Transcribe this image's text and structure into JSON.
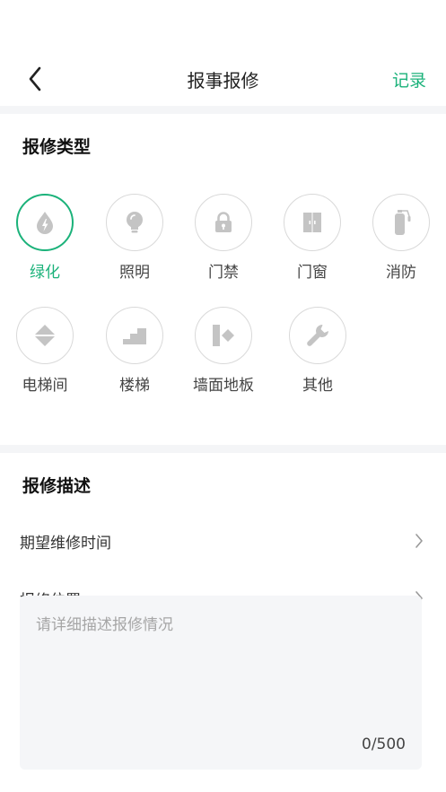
{
  "header": {
    "title": "报事报修",
    "record_label": "记录"
  },
  "type_section": {
    "title": "报修类型",
    "items": [
      {
        "label": "绿化",
        "icon": "water-drop-icon",
        "selected": true
      },
      {
        "label": "照明",
        "icon": "lightbulb-icon",
        "selected": false
      },
      {
        "label": "门禁",
        "icon": "lock-icon",
        "selected": false
      },
      {
        "label": "门窗",
        "icon": "double-door-icon",
        "selected": false
      },
      {
        "label": "消防",
        "icon": "fire-extinguisher-icon",
        "selected": false
      },
      {
        "label": "电梯间",
        "icon": "elevator-icon",
        "selected": false
      },
      {
        "label": "楼梯",
        "icon": "stairs-icon",
        "selected": false
      },
      {
        "label": "墙面地板",
        "icon": "wall-floor-icon",
        "selected": false
      },
      {
        "label": "其他",
        "icon": "wrench-icon",
        "selected": false
      }
    ]
  },
  "desc_section": {
    "title": "报修描述",
    "time_label": "期望维修时间",
    "location_label": "报修位置",
    "textarea_placeholder": "请详细描述报修情况",
    "char_count": "0/500"
  },
  "colors": {
    "accent": "#1bb27a",
    "icon_gray": "#c4c4c4",
    "divider": "#f4f5f7"
  }
}
